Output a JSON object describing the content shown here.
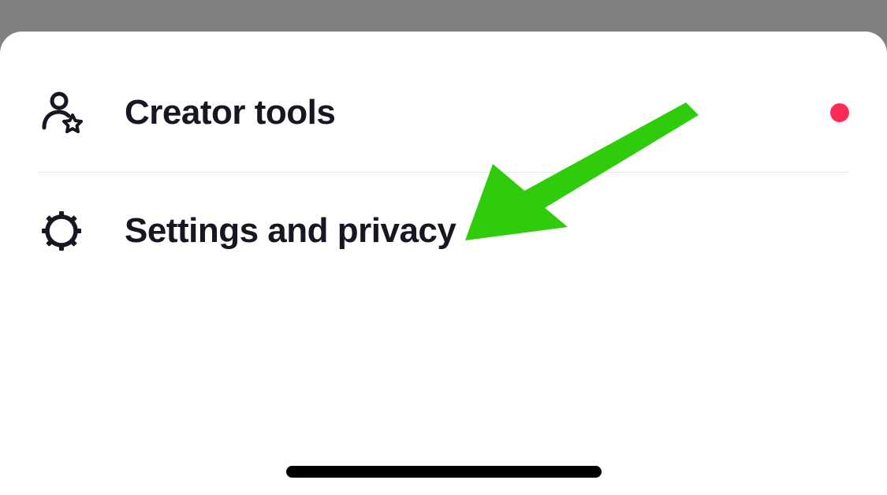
{
  "menu": {
    "items": [
      {
        "label": "Creator tools",
        "icon": "creator-tools-icon",
        "hasBadge": true
      },
      {
        "label": "Settings and privacy",
        "icon": "settings-icon",
        "hasBadge": false
      }
    ]
  },
  "colors": {
    "badge": "#fe2c55",
    "arrow": "#2ecc0a",
    "text": "#161722"
  }
}
